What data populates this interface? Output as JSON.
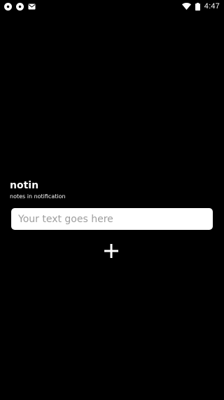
{
  "status_bar": {
    "time": "4:47",
    "left_icons": [
      "notification-app-icon",
      "notification-app-icon",
      "gmail-icon"
    ],
    "right_icons": [
      "wifi-icon",
      "battery-icon"
    ]
  },
  "app": {
    "title": "notin",
    "subtitle": "notes in notification"
  },
  "note_input": {
    "value": "",
    "placeholder": "Your text goes here"
  },
  "add_button": {
    "icon": "plus-icon"
  },
  "colors": {
    "background": "#000000",
    "foreground": "#ffffff",
    "input_background": "#ffffff",
    "placeholder": "#9e9e9e"
  }
}
